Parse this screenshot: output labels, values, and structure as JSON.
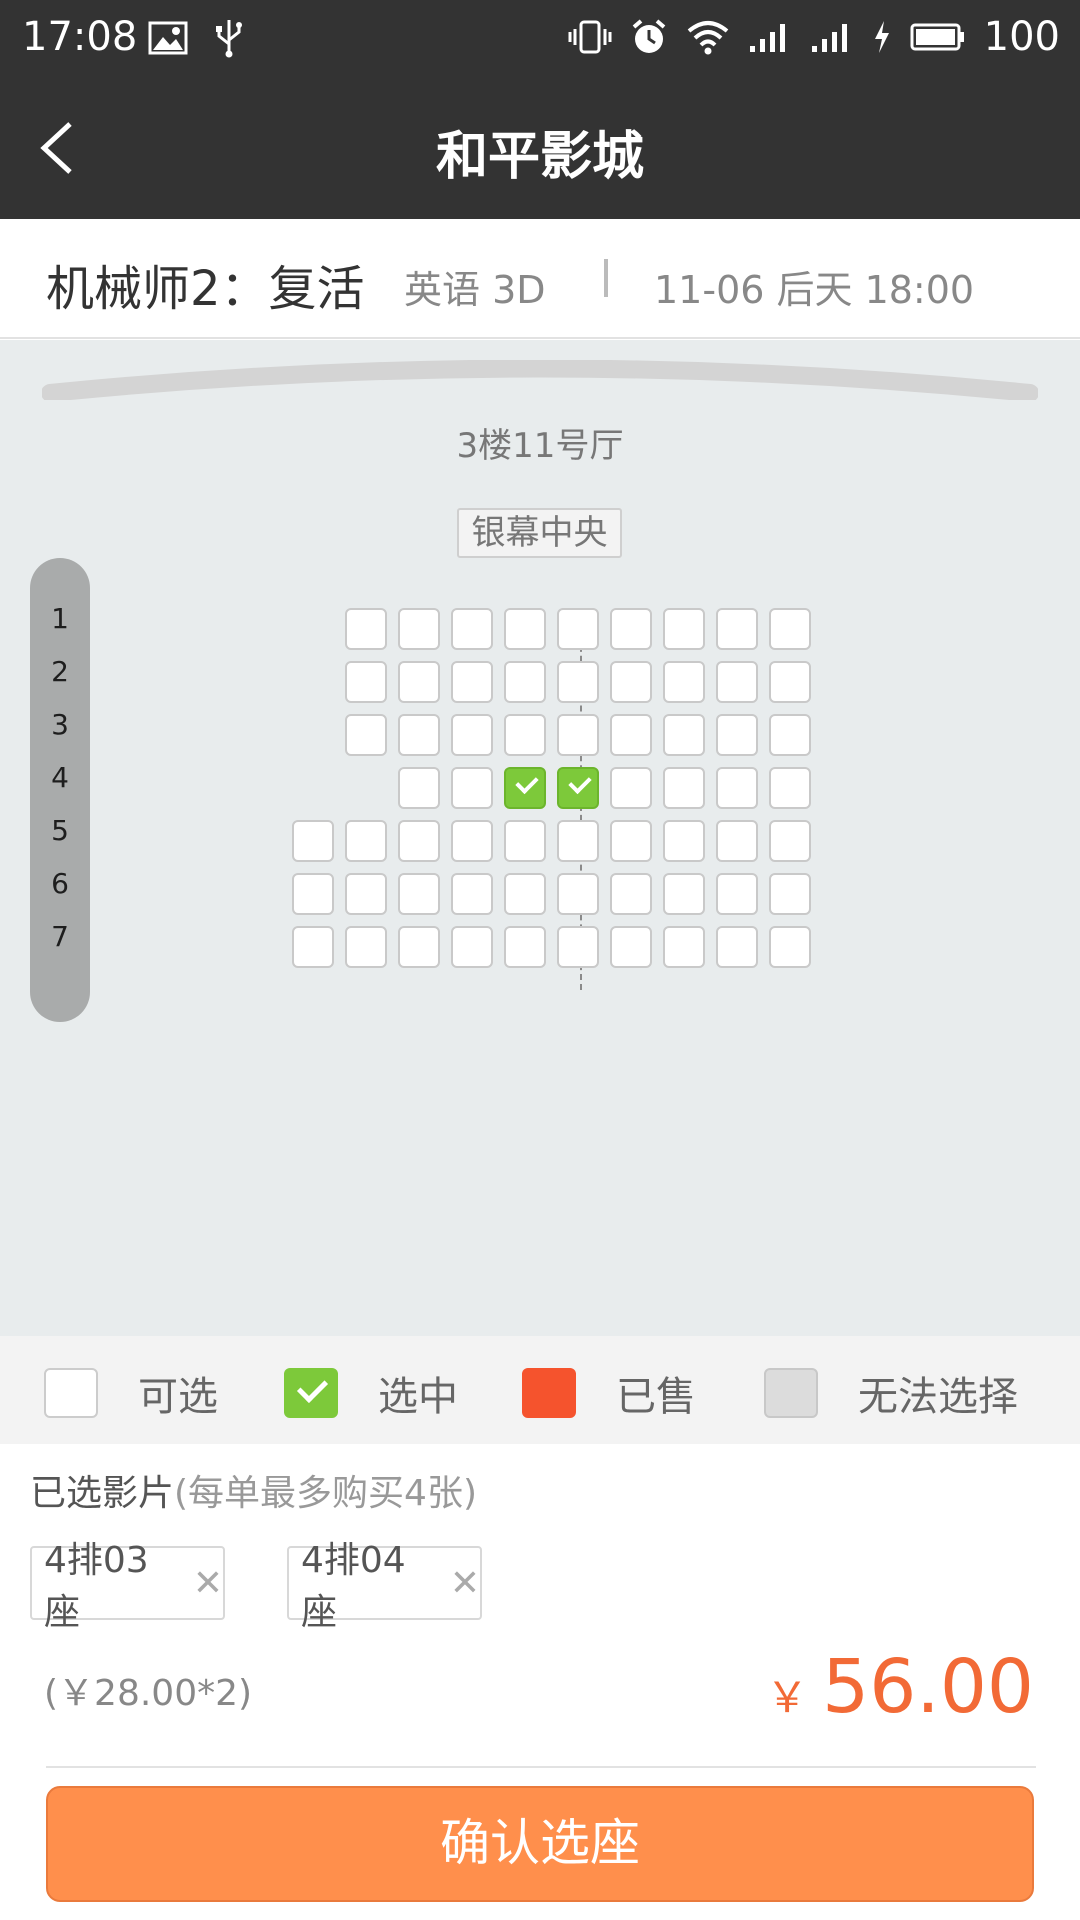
{
  "status_bar": {
    "time": "17:08",
    "battery": "100"
  },
  "header": {
    "title": "和平影城"
  },
  "movie": {
    "name": "机械师2：复活",
    "language": "英语 3D",
    "showtime": "11-06 后天 18:00"
  },
  "hall": {
    "name": "3楼11号厅",
    "center_label": "银幕中央"
  },
  "rows": [
    "1",
    "2",
    "3",
    "4",
    "5",
    "6",
    "7"
  ],
  "seat_map": [
    [
      0,
      0,
      1,
      1,
      1,
      1,
      1,
      1,
      1,
      1,
      1
    ],
    [
      0,
      0,
      1,
      1,
      1,
      1,
      1,
      1,
      1,
      1,
      1
    ],
    [
      0,
      0,
      1,
      1,
      1,
      1,
      1,
      1,
      1,
      1,
      1
    ],
    [
      0,
      0,
      0,
      1,
      1,
      2,
      2,
      1,
      1,
      1,
      1
    ],
    [
      0,
      1,
      1,
      1,
      1,
      1,
      1,
      1,
      1,
      1,
      1
    ],
    [
      0,
      1,
      1,
      1,
      1,
      1,
      1,
      1,
      1,
      1,
      1
    ],
    [
      0,
      1,
      1,
      1,
      1,
      1,
      1,
      1,
      1,
      1,
      1
    ]
  ],
  "legend": {
    "available": "可选",
    "selected": "选中",
    "sold": "已售",
    "unavailable": "无法选择"
  },
  "selection": {
    "title": "已选影片",
    "hint": "(每单最多购买4张)",
    "tickets": [
      "4排03座",
      "4排04座"
    ],
    "unit_price": "(￥28.00*2)",
    "currency": "￥",
    "total": "56.00"
  },
  "confirm_label": "确认选座",
  "colors": {
    "accent": "#ff8f4c",
    "selected_seat": "#7dc93a",
    "sold_seat": "#f5532d",
    "price": "#f26a36"
  }
}
